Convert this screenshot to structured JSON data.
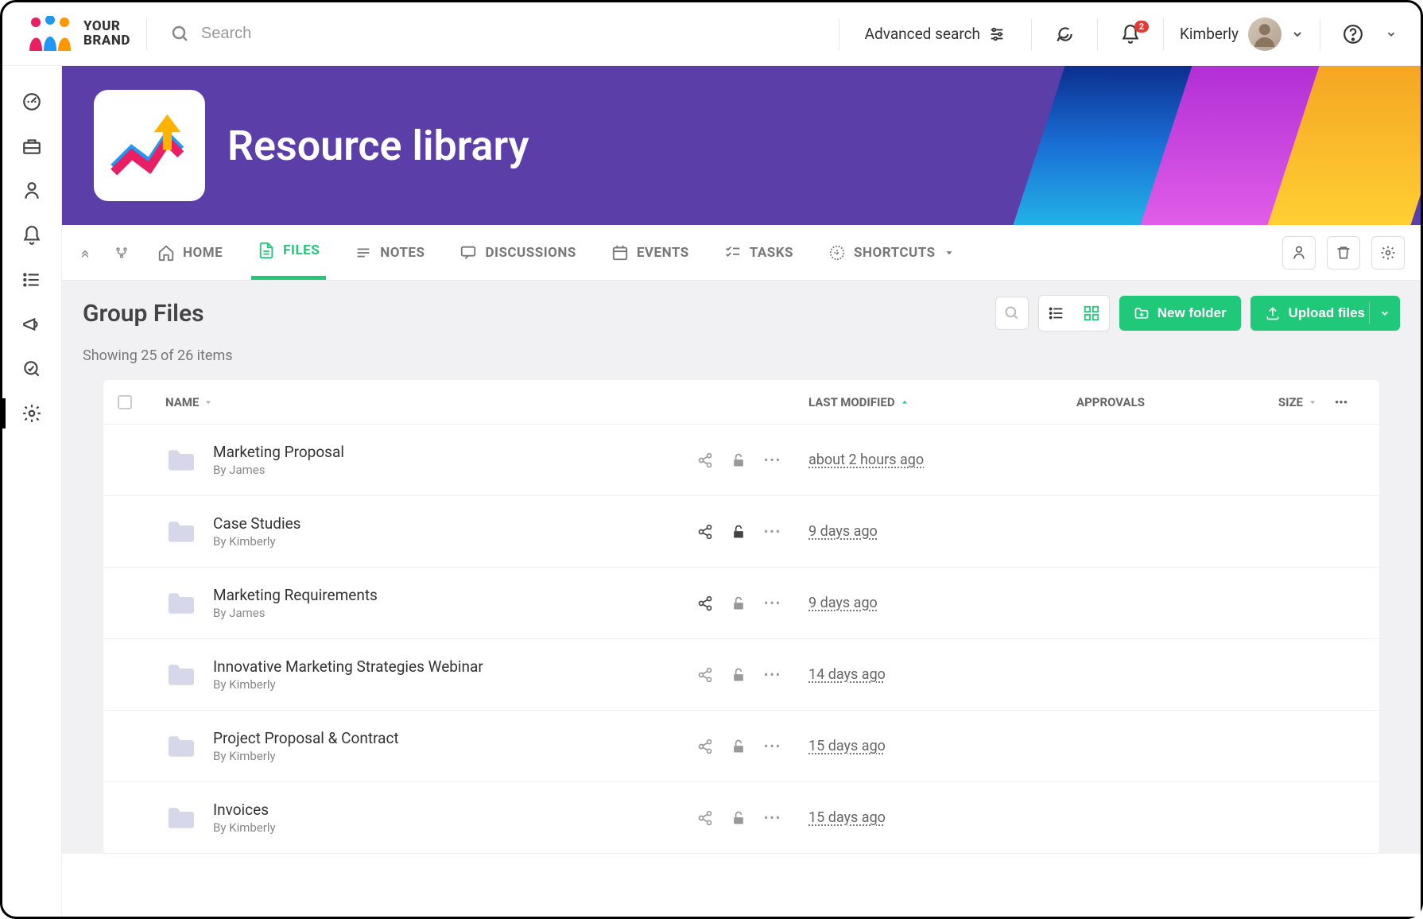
{
  "brand": {
    "line1": "YOUR",
    "line2": "BRAND"
  },
  "search": {
    "placeholder": "Search"
  },
  "advanced_search_label": "Advanced search",
  "notification_badge": "2",
  "user": {
    "name": "Kimberly"
  },
  "banner": {
    "title": "Resource library"
  },
  "tabs": {
    "home": "HOME",
    "files": "FILES",
    "notes": "NOTES",
    "discussions": "DISCUSSIONS",
    "events": "EVENTS",
    "tasks": "TASKS",
    "shortcuts": "SHORTCUTS"
  },
  "section_title": "Group Files",
  "count_text": "Showing 25 of 26 items",
  "buttons": {
    "new_folder": "New folder",
    "upload": "Upload files"
  },
  "columns": {
    "name": "NAME",
    "last_modified": "LAST MODIFIED",
    "approvals": "APPROVALS",
    "size": "SIZE"
  },
  "by_prefix": "By ",
  "files": [
    {
      "name": "Marketing Proposal",
      "by": "James",
      "modified": "about 2 hours ago",
      "shared": false,
      "locked": false
    },
    {
      "name": "Case Studies",
      "by": "Kimberly",
      "modified": "9 days ago",
      "shared": true,
      "locked": true
    },
    {
      "name": "Marketing Requirements",
      "by": "James",
      "modified": "9 days ago",
      "shared": true,
      "locked": false
    },
    {
      "name": "Innovative Marketing Strategies Webinar",
      "by": "Kimberly",
      "modified": "14 days ago",
      "shared": false,
      "locked": false
    },
    {
      "name": "Project Proposal & Contract",
      "by": "Kimberly",
      "modified": "15 days ago",
      "shared": false,
      "locked": false
    },
    {
      "name": "Invoices",
      "by": "Kimberly",
      "modified": "15 days ago",
      "shared": false,
      "locked": false
    }
  ]
}
